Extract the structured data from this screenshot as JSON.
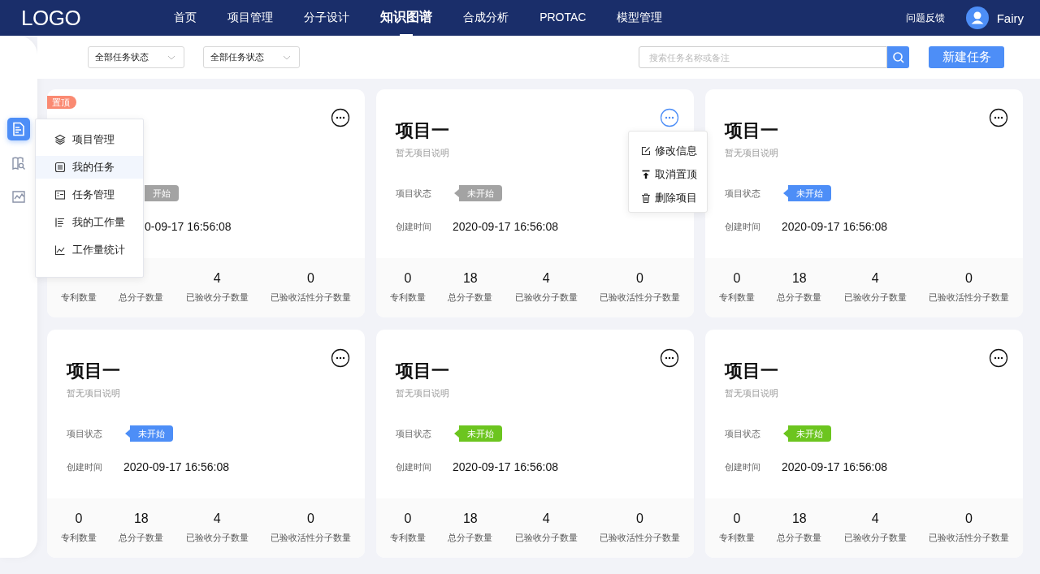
{
  "header": {
    "logo": "LOGO",
    "nav": [
      {
        "label": "首页",
        "selected": false
      },
      {
        "label": "项目管理",
        "selected": false
      },
      {
        "label": "分子设计",
        "selected": false
      },
      {
        "label": "知识图谱",
        "selected": true
      },
      {
        "label": "合成分析",
        "selected": false
      },
      {
        "label": "PROTAC",
        "selected": false
      },
      {
        "label": "模型管理",
        "selected": false
      }
    ],
    "feedback": "问题反馈",
    "user": "Fairy"
  },
  "filters": [
    {
      "value": "全部任务状态"
    },
    {
      "value": "全部任务状态"
    }
  ],
  "search": {
    "placeholder": "搜索任务名称或备注"
  },
  "new_button": "新建任务",
  "sidebar": {
    "items": [
      {
        "kind": "document",
        "selected": true
      },
      {
        "kind": "book",
        "selected": false
      },
      {
        "kind": "chart",
        "selected": false
      }
    ]
  },
  "sidebar_menu": {
    "items": [
      {
        "kind": "layers",
        "label": "项目管理",
        "selected": false
      },
      {
        "kind": "list",
        "label": "我的任务",
        "selected": true
      },
      {
        "kind": "card",
        "label": "任务管理",
        "selected": false
      },
      {
        "kind": "bars",
        "label": "我的工作量",
        "selected": false
      },
      {
        "kind": "line",
        "label": "工作量统计",
        "selected": false
      }
    ]
  },
  "projects": [
    {
      "badge": "置顶",
      "menu_open": false,
      "status": {
        "text": "开始",
        "color": "#a3a3a3"
      },
      "created": "0-09-17 16:56:08",
      "stats": [
        {
          "label": "专利数量"
        },
        {
          "label": "总分子数量"
        },
        {
          "value": "4",
          "label": "已验收分子数量"
        },
        {
          "value": "0",
          "label": "已验收活性分子数量"
        }
      ]
    },
    {
      "title": "项目一",
      "description": "暂无项目说明",
      "status_label": "项目状态",
      "status": {
        "text": "未开始",
        "color": "#a3a3a3"
      },
      "created_label": "创建时间",
      "created": "2020-09-17 16:56:08",
      "menu_open": true,
      "menu": [
        {
          "kind": "edit",
          "label": "修改信息"
        },
        {
          "kind": "pin",
          "label": "取消置顶"
        },
        {
          "kind": "trash",
          "label": "删除项目"
        }
      ],
      "stats": [
        {
          "value": "0",
          "label": "专利数量"
        },
        {
          "value": "18",
          "label": "总分子数量"
        },
        {
          "value": "4",
          "label": "已验收分子数量"
        },
        {
          "value": "0",
          "label": "已验收活性分子数量"
        }
      ]
    },
    {
      "title": "项目一",
      "description": "暂无项目说明",
      "status_label": "项目状态",
      "status": {
        "text": "未开始",
        "color": "#4d8ef7"
      },
      "created_label": "创建时间",
      "created": "2020-09-17 16:56:08",
      "menu_open": false,
      "stats": [
        {
          "value": "0",
          "label": "专利数量"
        },
        {
          "value": "18",
          "label": "总分子数量"
        },
        {
          "value": "4",
          "label": "已验收分子数量"
        },
        {
          "value": "0",
          "label": "已验收活性分子数量"
        }
      ]
    },
    {
      "title": "项目一",
      "description": "暂无项目说明",
      "status_label": "项目状态",
      "status": {
        "text": "未开始",
        "color": "#4d8ef7"
      },
      "created_label": "创建时间",
      "created": "2020-09-17 16:56:08",
      "menu_open": false,
      "stats": [
        {
          "value": "0",
          "label": "专利数量"
        },
        {
          "value": "18",
          "label": "总分子数量"
        },
        {
          "value": "4",
          "label": "已验收分子数量"
        },
        {
          "value": "0",
          "label": "已验收活性分子数量"
        }
      ]
    },
    {
      "title": "项目一",
      "description": "暂无项目说明",
      "status_label": "项目状态",
      "status": {
        "text": "未开始",
        "color": "#6cc51f"
      },
      "created_label": "创建时间",
      "created": "2020-09-17 16:56:08",
      "menu_open": false,
      "stats": [
        {
          "value": "0",
          "label": "专利数量"
        },
        {
          "value": "18",
          "label": "总分子数量"
        },
        {
          "value": "4",
          "label": "已验收分子数量"
        },
        {
          "value": "0",
          "label": "已验收活性分子数量"
        }
      ]
    },
    {
      "title": "项目一",
      "description": "暂无项目说明",
      "status_label": "项目状态",
      "status": {
        "text": "未开始",
        "color": "#6cc51f"
      },
      "created_label": "创建时间",
      "created": "2020-09-17 16:56:08",
      "menu_open": false,
      "stats": [
        {
          "value": "0",
          "label": "专利数量"
        },
        {
          "value": "18",
          "label": "总分子数量"
        },
        {
          "value": "4",
          "label": "已验收分子数量"
        },
        {
          "value": "0",
          "label": "已验收活性分子数量"
        }
      ]
    }
  ]
}
